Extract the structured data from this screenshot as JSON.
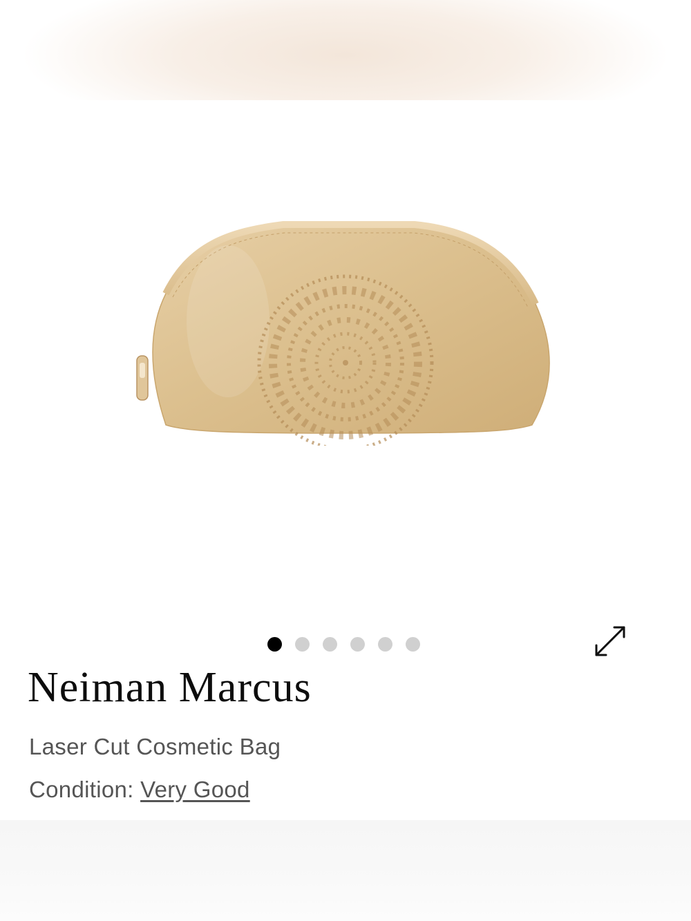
{
  "product": {
    "brand": "Neiman Marcus",
    "name": "Laser Cut Cosmetic Bag",
    "condition_label": "Condition:",
    "condition_value": "Very Good"
  },
  "gallery": {
    "image_count": 6,
    "active_index": 0,
    "dots": [
      {
        "active": true
      },
      {
        "active": false
      },
      {
        "active": false
      },
      {
        "active": false
      },
      {
        "active": false
      },
      {
        "active": false
      }
    ],
    "expand_icon": "expand-arrows-icon"
  },
  "colors": {
    "bag_gold": "#dcc08f",
    "text_primary": "#0d0d0d",
    "text_secondary": "#555555",
    "dot_active": "#000000",
    "dot_inactive": "#d0d0d0"
  }
}
